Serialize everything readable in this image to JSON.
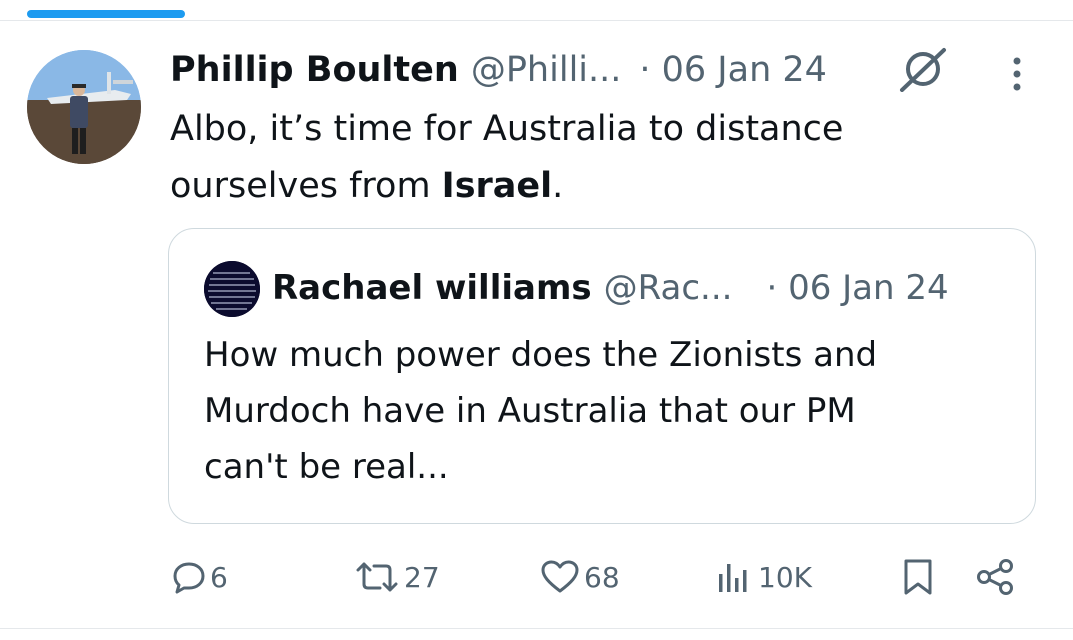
{
  "tweet": {
    "author_name": "Phillip Boulten",
    "author_handle": "@Philli...",
    "date": "· 06 Jan 24",
    "text_line1": "Albo, it’s time for Australia to distance",
    "text_line2_prefix": "ourselves from ",
    "text_line2_bold": "Israel",
    "text_line2_suffix": "."
  },
  "quote": {
    "author_name": "Rachael williams",
    "author_handle": "@Rac...",
    "date": "· 06 Jan 24",
    "text_line1": "How much power does the Zionists and",
    "text_line2": "Murdoch have in Australia that our PM",
    "text_line3": "can't be real..."
  },
  "actions": {
    "replies": "6",
    "reposts": "27",
    "likes": "68",
    "views": "10K"
  },
  "icons": {
    "reply": "reply-icon",
    "repost": "repost-icon",
    "like": "heart-icon",
    "views": "views-icon",
    "bookmark": "bookmark-icon",
    "share": "share-icon",
    "grok": "grok-icon",
    "more": "more-vertical-icon"
  },
  "colors": {
    "accent": "#1d9bf0",
    "text": "#0f1419",
    "secondary": "#536471",
    "border": "#cfd9de"
  }
}
